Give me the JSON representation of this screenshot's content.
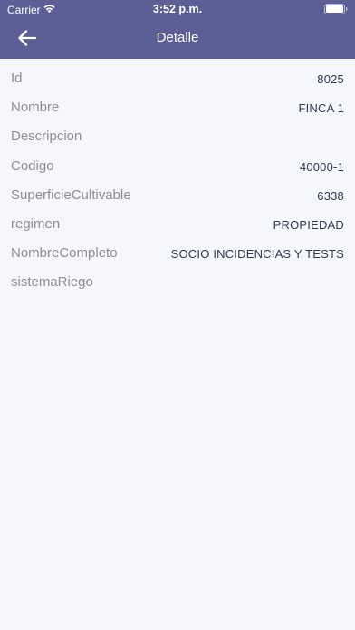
{
  "status_bar": {
    "carrier": "Carrier",
    "time": "3:52 p.m."
  },
  "header": {
    "title": "Detalle",
    "back_icon": "arrow-left-icon",
    "background_color": "#5C5F96"
  },
  "details": [
    {
      "label": "Id",
      "value": "8025"
    },
    {
      "label": "Nombre",
      "value": "FINCA 1"
    },
    {
      "label": "Descripcion",
      "value": ""
    },
    {
      "label": "Codigo",
      "value": "40000-1"
    },
    {
      "label": "SuperficieCultivable",
      "value": "6338"
    },
    {
      "label": "regimen",
      "value": "PROPIEDAD"
    },
    {
      "label": "NombreCompleto",
      "value": "SOCIO INCIDENCIAS Y TESTS"
    },
    {
      "label": "sistemaRiego",
      "value": ""
    }
  ]
}
